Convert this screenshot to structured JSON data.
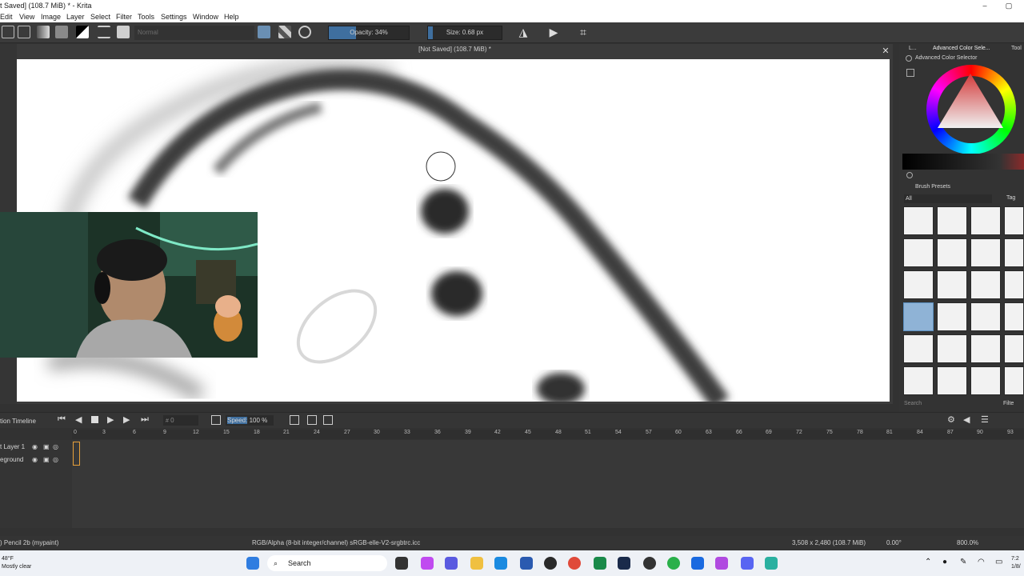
{
  "window": {
    "title": "t Saved]  (108.7 MiB) * - Krita",
    "controls": [
      "–",
      "▢"
    ]
  },
  "menu": [
    "Edit",
    "View",
    "Image",
    "Layer",
    "Select",
    "Filter",
    "Tools",
    "Settings",
    "Window",
    "Help"
  ],
  "toolbar": {
    "blend_mode": "Normal",
    "opacity": {
      "label": "Opacity: 34%",
      "value": 0.34
    },
    "size": {
      "label": "Size: 0.68 px"
    }
  },
  "document": {
    "tab_title": "[Not Saved]  (108.7 MiB) *",
    "close": "✕"
  },
  "dockers": {
    "tab_short": "L...",
    "tab_active": "Advanced Color Sele...",
    "tab_tool": "Tool",
    "color_selector_title": "Advanced Color Selector",
    "brush_presets_title": "Brush Presets",
    "filter_all": "All",
    "tag_label": "Tag",
    "search_placeholder": "Search",
    "filter_label": "Filte"
  },
  "timeline": {
    "title": "tion Timeline",
    "frame": "0",
    "speed_label": "Speed:",
    "speed_value": "100 %",
    "ruler": [
      "0",
      "3",
      "6",
      "9",
      "12",
      "15",
      "18",
      "21",
      "24",
      "27",
      "30",
      "33",
      "36",
      "39",
      "42",
      "45",
      "48",
      "51",
      "54",
      "57",
      "60",
      "63",
      "66",
      "69",
      "72",
      "75",
      "78",
      "81",
      "84",
      "87",
      "90",
      "93"
    ],
    "layers": [
      {
        "name": "t Layer 1"
      },
      {
        "name": "eground"
      }
    ]
  },
  "status": {
    "brush": ") Pencil 2b (mypaint)",
    "color_space": "RGB/Alpha (8-bit integer/channel)  sRGB-elle-V2-srgbtrc.icc",
    "dimensions": "3,508 x 2,480 (108.7 MiB)",
    "rotation": "0.00°",
    "zoom": "800.0%"
  },
  "taskbar": {
    "weather_temp": "48°F",
    "weather_desc": "Mostly clear",
    "search": "Search",
    "time": "7:2",
    "date": "1/8/"
  }
}
